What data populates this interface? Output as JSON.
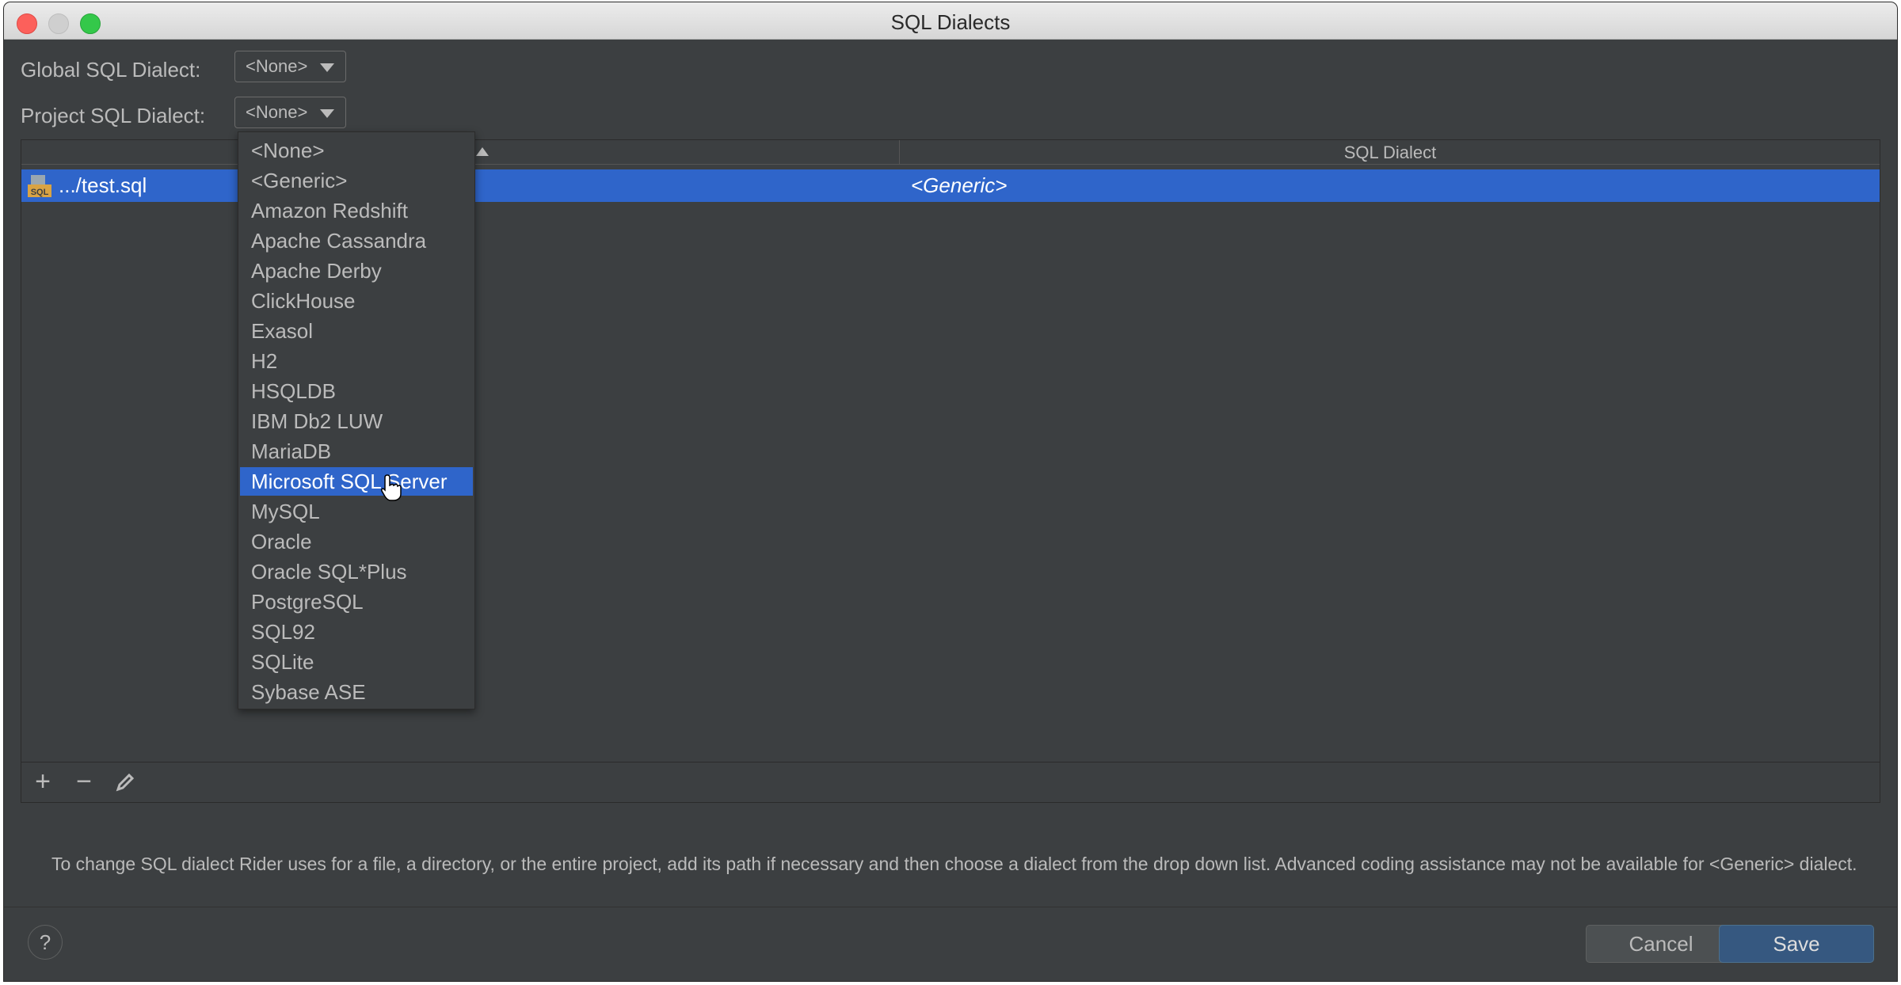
{
  "window": {
    "title": "SQL Dialects"
  },
  "global_dialect": {
    "label": "Global SQL Dialect:",
    "value": "<None>"
  },
  "project_dialect": {
    "label": "Project SQL Dialect:",
    "value": "<None>"
  },
  "table": {
    "columns": [
      "",
      "SQL Dialect"
    ],
    "rows": [
      {
        "path": ".../test.sql",
        "dialect": "<Generic>"
      }
    ]
  },
  "dropdown": {
    "items": [
      "<None>",
      "<Generic>",
      "Amazon Redshift",
      "Apache Cassandra",
      "Apache Derby",
      "ClickHouse",
      "Exasol",
      "H2",
      "HSQLDB",
      "IBM Db2 LUW",
      "MariaDB",
      "Microsoft SQL Server",
      "MySQL",
      "Oracle",
      "Oracle SQL*Plus",
      "PostgreSQL",
      "SQL92",
      "SQLite",
      "Sybase ASE"
    ],
    "selected": "Microsoft SQL Server"
  },
  "toolbar": {
    "add": "+",
    "remove": "−",
    "edit": "edit"
  },
  "hint": "To change SQL dialect Rider uses for a file, a directory, or the entire project, add its path if necessary and then choose a dialect from the drop down list. Advanced coding assistance may not be available for <Generic> dialect.",
  "buttons": {
    "help": "?",
    "cancel": "Cancel",
    "save": "Save"
  },
  "colors": {
    "background": "#3c3f41",
    "selection": "#2f65ca",
    "save_button": "#365880"
  }
}
